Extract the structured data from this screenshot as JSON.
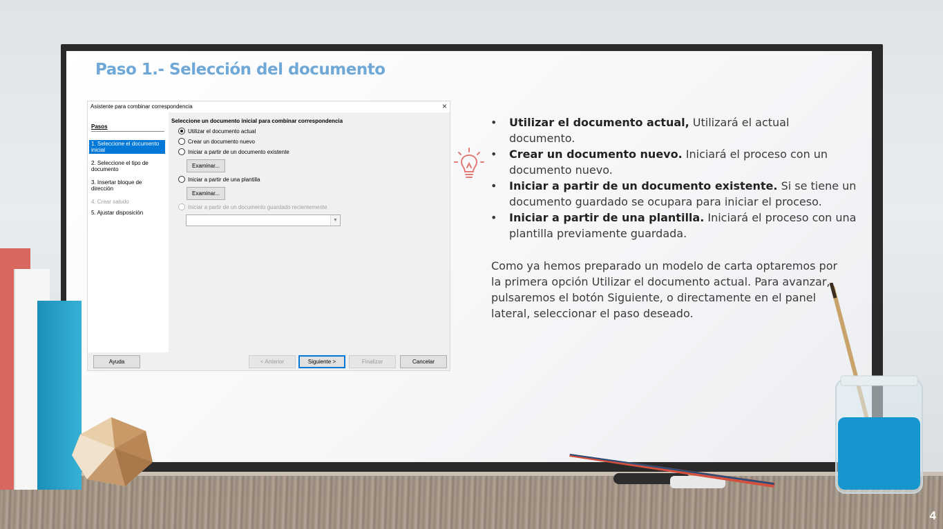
{
  "slide": {
    "title": "Paso 1.- Selección del documento",
    "page_number": "4"
  },
  "dialog": {
    "title": "Asistente para combinar correspondencia",
    "close_glyph": "×",
    "steps_heading": "Pasos",
    "steps": [
      {
        "label": "1. Seleccione el documento inicial",
        "state": "active"
      },
      {
        "label": "2. Seleccione el tipo de documento",
        "state": "normal"
      },
      {
        "label": "3. Insertar bloque de dirección",
        "state": "normal"
      },
      {
        "label": "4. Crear saludo",
        "state": "disabled"
      },
      {
        "label": "5. Ajustar disposición",
        "state": "normal"
      }
    ],
    "heading": "Seleccione un documento inicial para combinar correspondencia",
    "options": [
      {
        "label": "Utilizar el documento actual",
        "checked": true,
        "enabled": true
      },
      {
        "label": "Crear un documento nuevo",
        "checked": false,
        "enabled": true
      },
      {
        "label": "Iniciar a partir de un documento existente",
        "checked": false,
        "enabled": true
      },
      {
        "label": "Iniciar a partir de una plantilla",
        "checked": false,
        "enabled": true
      },
      {
        "label": "Iniciar a partir de un documento guardado recientemente",
        "checked": false,
        "enabled": false
      }
    ],
    "browse_label_1": "Examinar...",
    "browse_label_2": "Examinar...",
    "recent_combo_value": "",
    "buttons": {
      "help": "Ayuda",
      "previous": "< Anterior",
      "next": "Siguiente >",
      "finish": "Finalizar",
      "cancel": "Cancelar"
    }
  },
  "bullets": [
    {
      "bold": "Utilizar el documento actual,",
      "text": " Utilizará el actual documento."
    },
    {
      "bold": "Crear un documento nuevo.",
      "text": " Iniciará el proceso con un documento nuevo."
    },
    {
      "bold": "Iniciar a partir de un documento existente.",
      "text": " Si se tiene un documento guardado se ocupara para iniciar el proceso."
    },
    {
      "bold": "Iniciar a partir de una plantilla.",
      "text": " Iniciará el proceso con una plantilla previamente guardada."
    }
  ],
  "paragraph": "Como ya hemos preparado un modelo de carta optaremos por la primera opción Utilizar el documento actual.  Para avanzar, pulsaremos el botón Siguiente, o directamente en el panel lateral, seleccionar el paso deseado.",
  "colors": {
    "title": "#6fa8d6",
    "active_step": "#0078d7",
    "bulb": "#e07a72"
  }
}
